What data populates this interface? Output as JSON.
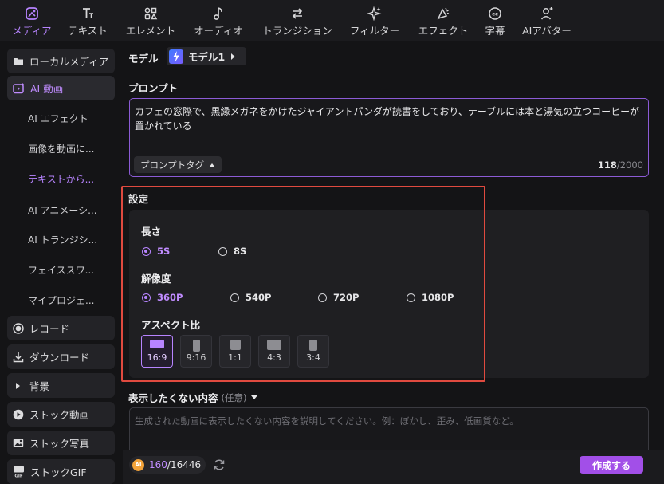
{
  "toolbar": {
    "tabs": [
      {
        "label": "メディア",
        "icon": "media-icon"
      },
      {
        "label": "テキスト",
        "icon": "text-icon"
      },
      {
        "label": "エレメント",
        "icon": "elements-icon"
      },
      {
        "label": "オーディオ",
        "icon": "music-note-icon"
      },
      {
        "label": "トランジション",
        "icon": "transition-arrows-icon"
      },
      {
        "label": "フィルター",
        "icon": "sparkle-icon"
      },
      {
        "label": "エフェクト",
        "icon": "effects-icon"
      },
      {
        "label": "字幕",
        "icon": "cc-subtitle-icon"
      },
      {
        "label": "AIアバター",
        "icon": "avatar-icon"
      }
    ],
    "active_index": 0
  },
  "sidebar": {
    "items": [
      {
        "label": "ローカルメディア",
        "icon": "folder-icon"
      },
      {
        "label": "AI 動画",
        "icon": "ai-video-icon"
      },
      {
        "label": "レコード",
        "icon": "record-icon"
      },
      {
        "label": "ダウンロード",
        "icon": "download-icon"
      },
      {
        "label": "背景",
        "icon": "triangle-right-icon"
      },
      {
        "label": "ストック動画",
        "icon": "play-icon"
      },
      {
        "label": "ストック写真",
        "icon": "photo-icon"
      },
      {
        "label": "ストックGIF",
        "icon": "gif-icon"
      }
    ],
    "subitems": [
      {
        "label": "AI エフェクト"
      },
      {
        "label": "画像を動画に..."
      },
      {
        "label": "テキストから..."
      },
      {
        "label": "AI アニメーシ..."
      },
      {
        "label": "AI トランジシ..."
      },
      {
        "label": "フェイススワ..."
      },
      {
        "label": "マイプロジェ..."
      }
    ]
  },
  "model": {
    "label": "モデル",
    "value": "モデル1"
  },
  "prompt": {
    "label": "プロンプト",
    "text": "カフェの窓際で、黒縁メガネをかけたジャイアントパンダが読書をしており、テーブルには本と湯気の立つコーヒーが置かれている",
    "tag_button": "プロンプトタグ",
    "count": "118",
    "max": "/2000"
  },
  "settings": {
    "title": "設定",
    "length": {
      "label": "長さ",
      "options": [
        "5S",
        "8S"
      ],
      "selected": "5S"
    },
    "resolution": {
      "label": "解像度",
      "options": [
        "360P",
        "540P",
        "720P",
        "1080P"
      ],
      "selected": "360P"
    },
    "aspect": {
      "label": "アスペクト比",
      "options": [
        "16:9",
        "9:16",
        "1:1",
        "4:3",
        "3:4"
      ],
      "selected": "16:9"
    }
  },
  "negative": {
    "label": "表示したくない内容",
    "optional": "(任意)",
    "placeholder": "生成された動画に表示したくない内容を説明してください。例：ぼかし、歪み、低画質など。"
  },
  "footer": {
    "credit_badge": "AI",
    "credits_current": "160",
    "credits_total": "/16446",
    "create_label": "作成する"
  },
  "colors": {
    "accent": "#b784ff",
    "button": "#a24fe8",
    "highlight_frame": "#e04a3f"
  }
}
